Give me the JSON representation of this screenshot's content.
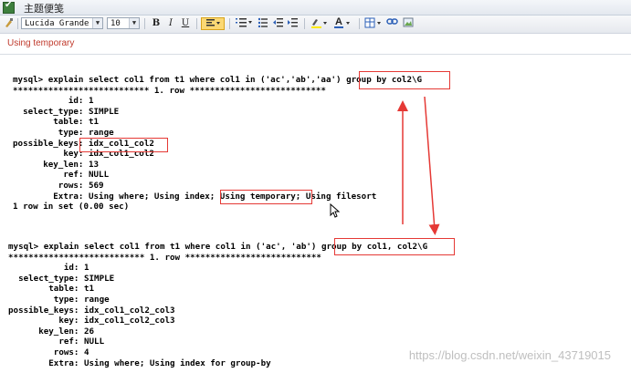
{
  "window": {
    "title": "主题便笺"
  },
  "toolbar": {
    "font_family": "Lucida Grande",
    "font_size": "10",
    "bold": "B",
    "italic": "I",
    "underline": "U",
    "font_color_letter": "A"
  },
  "heading": {
    "text": "Using temporary"
  },
  "terminal": {
    "block1": "mysql> explain select col1 from t1 where col1 in ('ac','ab','aa') group by col2\\G\n*************************** 1. row ***************************\n           id: 1\n  select_type: SIMPLE\n        table: t1\n         type: range\npossible_keys: idx_col1_col2\n          key: idx_col1_col2\n      key_len: 13\n          ref: NULL\n         rows: 569\n        Extra: Using where; Using index; Using temporary; Using filesort\n1 row in set (0.00 sec)",
    "block2": "mysql> explain select col1 from t1 where col1 in ('ac', 'ab') group by col1, col2\\G\n*************************** 1. row ***************************\n           id: 1\n  select_type: SIMPLE\n        table: t1\n         type: range\npossible_keys: idx_col1_col2_col3\n          key: idx_col1_col2_col3\n      key_len: 26\n          ref: NULL\n         rows: 4\n        Extra: Using where; Using index for group-by"
  },
  "watermark": {
    "text": "https://blog.csdn.net/weixin_43719015"
  },
  "colors": {
    "highlight_box": "#e53935",
    "heading_text": "#c0392b"
  }
}
